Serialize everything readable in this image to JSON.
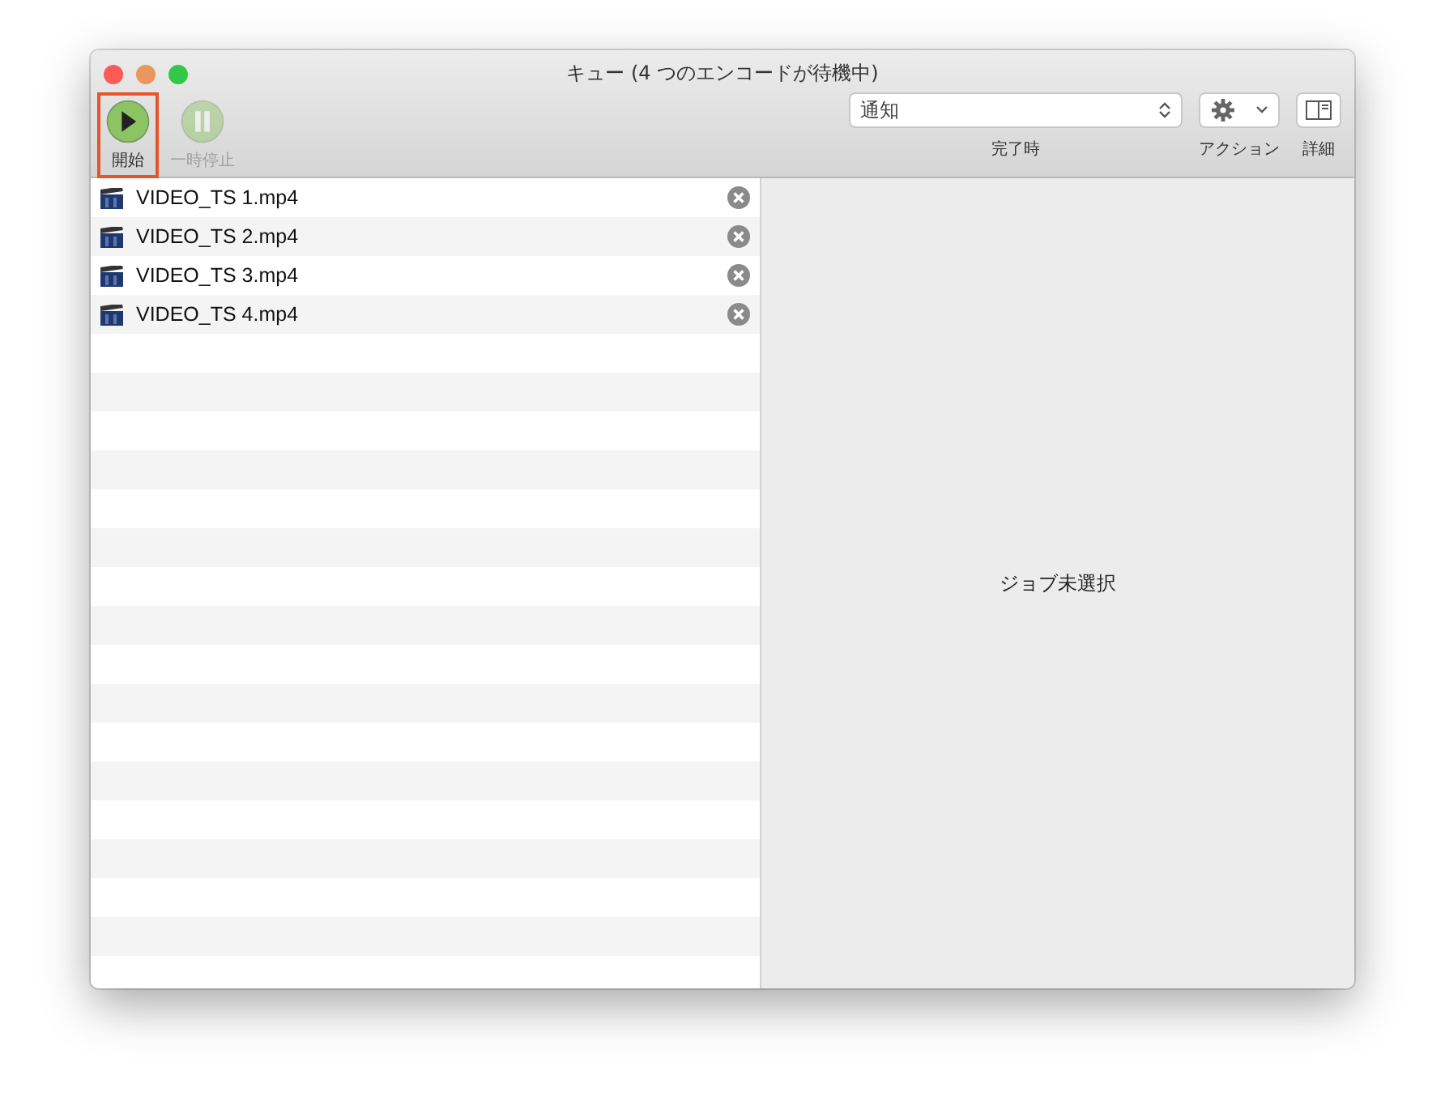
{
  "window": {
    "title": "キュー (4 つのエンコードが待機中)"
  },
  "toolbar": {
    "buttons": [
      {
        "kind": "start",
        "label": "開始",
        "disabled": false,
        "highlighted": true
      },
      {
        "kind": "pause",
        "label": "一時停止",
        "disabled": true,
        "highlighted": false
      }
    ],
    "when_done": {
      "value": "通知",
      "label": "完了時"
    },
    "action": {
      "label": "アクション"
    },
    "details": {
      "label": "詳細"
    }
  },
  "jobs": [
    {
      "name": "VIDEO_TS 1.mp4"
    },
    {
      "name": "VIDEO_TS 2.mp4"
    },
    {
      "name": "VIDEO_TS 3.mp4"
    },
    {
      "name": "VIDEO_TS 4.mp4"
    }
  ],
  "detail_pane": {
    "message": "ジョブ未選択"
  }
}
